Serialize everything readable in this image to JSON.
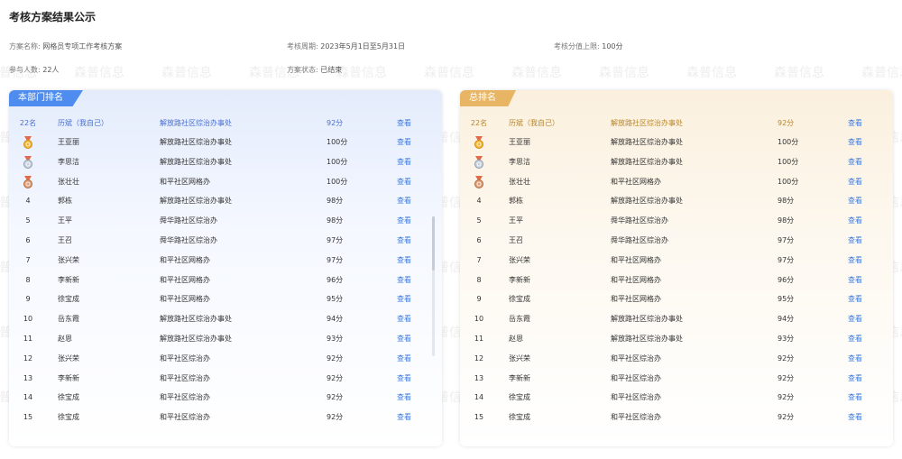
{
  "page_title": "考核方案结果公示",
  "info": {
    "plan_name_label": "方案名称:",
    "plan_name": "网格员专项工作考核方案",
    "period_label": "考核周期:",
    "period": "2023年5月1日至5月31日",
    "score_cap_label": "考核分值上限:",
    "score_cap": "100分",
    "participants_label": "参与人数:",
    "participants": "22人",
    "status_label": "方案状态:",
    "status": "已结束"
  },
  "watermark_text": "森普信息",
  "view_label": "查看",
  "dept_panel": {
    "title": "本部门排名",
    "my_row": {
      "rank": "22名",
      "name": "历斌（我自己）",
      "org": "解放路社区综治办事处",
      "score": "92分"
    }
  },
  "total_panel": {
    "title": "总排名",
    "my_row": {
      "rank": "22名",
      "name": "历斌（我自己）",
      "org": "解放路社区综治办事处",
      "score": "92分"
    }
  },
  "rows": [
    {
      "rank": "1",
      "medal": "gold",
      "name": "王亚丽",
      "org": "解放路社区综治办事处",
      "score": "100分"
    },
    {
      "rank": "2",
      "medal": "silver",
      "name": "李思洁",
      "org": "解放路社区综治办事处",
      "score": "100分"
    },
    {
      "rank": "3",
      "medal": "bronze",
      "name": "张壮壮",
      "org": "和平社区网格办",
      "score": "100分"
    },
    {
      "rank": "4",
      "name": "郭栋",
      "org": "解放路社区综治办事处",
      "score": "98分"
    },
    {
      "rank": "5",
      "name": "王平",
      "org": "舜华路社区综治办",
      "score": "98分"
    },
    {
      "rank": "6",
      "name": "王召",
      "org": "舜华路社区综治办",
      "score": "97分"
    },
    {
      "rank": "7",
      "name": "张兴荣",
      "org": "和平社区网格办",
      "score": "97分"
    },
    {
      "rank": "8",
      "name": "李新新",
      "org": "和平社区网格办",
      "score": "96分"
    },
    {
      "rank": "9",
      "name": "徐宝成",
      "org": "和平社区网格办",
      "score": "95分"
    },
    {
      "rank": "10",
      "name": "岳东霞",
      "org": "解放路社区综治办事处",
      "score": "94分"
    },
    {
      "rank": "11",
      "name": "赵恩",
      "org": "解放路社区综治办事处",
      "score": "93分"
    },
    {
      "rank": "12",
      "name": "张兴荣",
      "org": "和平社区综治办",
      "score": "92分"
    },
    {
      "rank": "13",
      "name": "李新新",
      "org": "和平社区综治办",
      "score": "92分"
    },
    {
      "rank": "14",
      "name": "徐宝成",
      "org": "和平社区综治办",
      "score": "92分"
    },
    {
      "rank": "15",
      "name": "徐宝成",
      "org": "和平社区综治办",
      "score": "92分"
    }
  ],
  "colors": {
    "dept_accent": "#4f8cf0",
    "total_accent": "#e8b565",
    "link": "#3a7ae0"
  }
}
